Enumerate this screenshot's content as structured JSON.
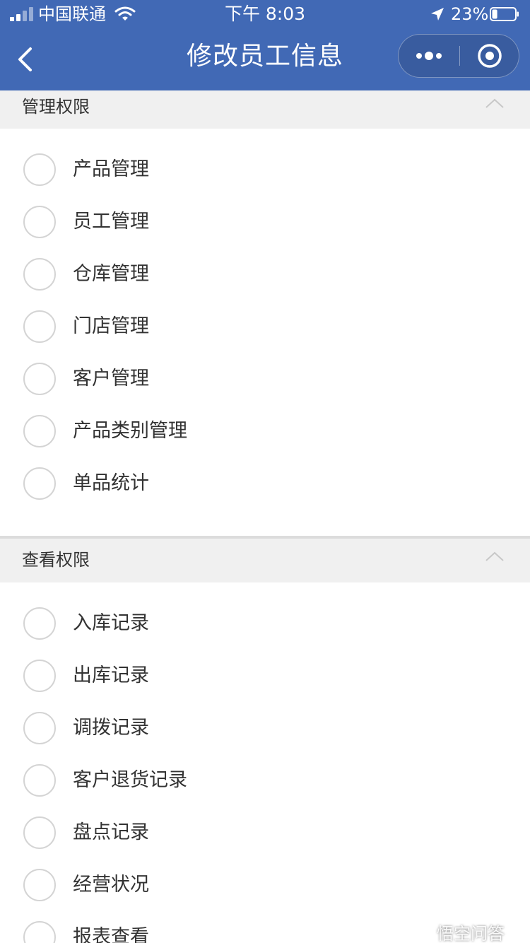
{
  "status_bar": {
    "carrier": "中国联通",
    "time": "下午 8:03",
    "battery_percent": "23%",
    "battery_level": 0.23
  },
  "nav": {
    "title": "修改员工信息"
  },
  "sections": [
    {
      "title": "管理权限",
      "items": [
        "产品管理",
        "员工管理",
        "仓库管理",
        "门店管理",
        "客户管理",
        "产品类别管理",
        "单品统计"
      ]
    },
    {
      "title": "查看权限",
      "items": [
        "入库记录",
        "出库记录",
        "调拨记录",
        "客户退货记录",
        "盘点记录",
        "经营状况",
        "报表查看"
      ]
    }
  ],
  "watermark": {
    "text": "悟空问答"
  },
  "colors": {
    "nav_bg": "#4169b5",
    "section_header_bg": "#f0f0f0",
    "radio_border": "#d4d4d4",
    "text": "#333333"
  }
}
